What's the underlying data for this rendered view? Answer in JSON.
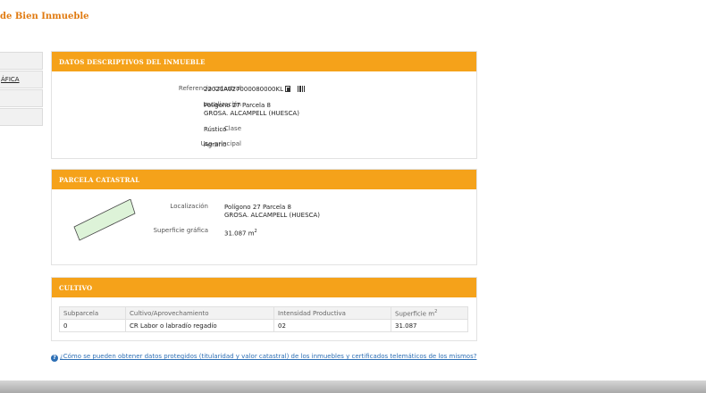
{
  "page_title": "de Bien Inmueble",
  "sidebar": {
    "items": [
      {
        "label": ""
      },
      {
        "label": "ÁFICA"
      },
      {
        "label": ""
      },
      {
        "label": ""
      }
    ]
  },
  "datos_descriptivos": {
    "header": "DATOS DESCRIPTIVOS DEL INMUEBLE",
    "referencia_label": "Referencia catastral",
    "referencia_value": "22021A027000080000KL",
    "localizacion_label": "Localización",
    "localizacion_line1": "Polígono 27 Parcela 8",
    "localizacion_line2": "GROSA. ALCAMPELL (HUESCA)",
    "clase_label": "Clase",
    "clase_value": "Rústico",
    "uso_label": "Uso principal",
    "uso_value": "Agrario"
  },
  "parcela": {
    "header": "PARCELA CATASTRAL",
    "localizacion_label": "Localización",
    "localizacion_line1": "Polígono 27 Parcela 8",
    "localizacion_line2": "GROSA. ALCAMPELL (HUESCA)",
    "superficie_label": "Superficie gráfica",
    "superficie_value": "31.087 m",
    "superficie_unit_exp": "2",
    "shape_fill": "#ddf3d8",
    "shape_stroke": "#444444"
  },
  "cultivo": {
    "header": "CULTIVO",
    "columns": [
      "Subparcela",
      "Cultivo/Aprovechamiento",
      "Intensidad Productiva",
      "Superficie m"
    ],
    "columns_exp": "2",
    "rows": [
      [
        "0",
        "CR Labor o labradío regadío",
        "02",
        "31.087"
      ]
    ]
  },
  "help": {
    "icon": "question-circle-icon",
    "text": "¿Cómo se pueden obtener datos protegidos (titularidad y valor catastral) de los inmuebles y certificados telemáticos de los mismos?"
  },
  "colors": {
    "accent_orange": "#f5a21a",
    "title_orange": "#e07a10",
    "link_blue": "#2d6fb5"
  }
}
